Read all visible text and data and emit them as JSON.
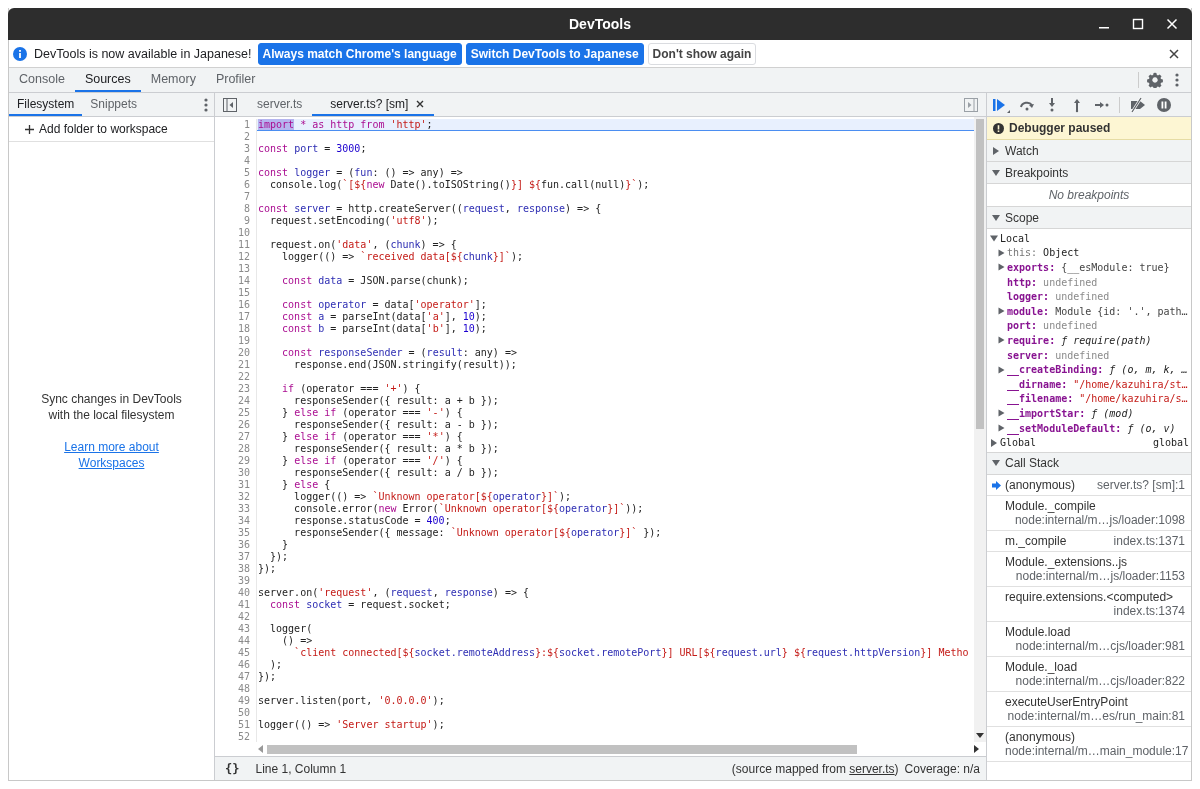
{
  "window": {
    "title": "DevTools"
  },
  "infobar": {
    "message": "DevTools is now available in Japanese!",
    "buttons": [
      {
        "label": "Always match Chrome's language",
        "primary": true
      },
      {
        "label": "Switch DevTools to Japanese",
        "primary": true
      },
      {
        "label": "Don't show again",
        "primary": false
      }
    ]
  },
  "main_tabs": [
    {
      "label": "Console",
      "selected": false
    },
    {
      "label": "Sources",
      "selected": true
    },
    {
      "label": "Memory",
      "selected": false
    },
    {
      "label": "Profiler",
      "selected": false
    }
  ],
  "navigator": {
    "tabs": [
      {
        "label": "Filesystem",
        "selected": true
      },
      {
        "label": "Snippets",
        "selected": false
      }
    ],
    "add_folder": "Add folder to workspace",
    "empty_message": "Sync changes in DevTools with the local filesystem",
    "learn_more_link": "Learn more about Workspaces"
  },
  "editor": {
    "tabs": [
      {
        "label": "server.ts",
        "selected": false,
        "closable": false
      },
      {
        "label": "server.ts? [sm]",
        "selected": true,
        "closable": true
      }
    ],
    "lines": [
      {
        "number": "1",
        "current": true,
        "tokens": [
          {
            "kind": "keyword",
            "text": "import",
            "selected": true
          },
          {
            "kind": "keyword",
            "text": " * as http from "
          },
          {
            "kind": "string",
            "text": "'http'"
          },
          {
            "kind": "plain",
            "text": ";"
          }
        ]
      },
      {
        "number": "2",
        "current": false
      },
      {
        "number": "3",
        "current": false,
        "tokens": [
          {
            "kind": "keyword",
            "text": "const "
          },
          {
            "kind": "variable",
            "text": "port"
          },
          {
            "kind": "plain",
            "text": " = "
          },
          {
            "kind": "number",
            "text": "3000"
          },
          {
            "kind": "plain",
            "text": ";"
          }
        ]
      },
      {
        "number": "4",
        "current": false
      },
      {
        "number": "5",
        "current": false,
        "tokens": [
          {
            "kind": "keyword",
            "text": "const "
          },
          {
            "kind": "variable",
            "text": "logger"
          },
          {
            "kind": "plain",
            "text": " = ("
          },
          {
            "kind": "variable",
            "text": "fun"
          },
          {
            "kind": "plain",
            "text": ": () => any) =>"
          }
        ]
      },
      {
        "number": "6",
        "current": false,
        "tokens": [
          {
            "kind": "plain",
            "text": "  console.log("
          },
          {
            "kind": "string",
            "text": "`[${"
          },
          {
            "kind": "keyword",
            "text": "new"
          },
          {
            "kind": "plain",
            "text": " Date().toISOString()"
          },
          {
            "kind": "string",
            "text": "}] ${"
          },
          {
            "kind": "plain",
            "text": "fun.call(null)"
          },
          {
            "kind": "string",
            "text": "}`"
          },
          {
            "kind": "plain",
            "text": ");"
          }
        ]
      },
      {
        "number": "7",
        "current": false
      },
      {
        "number": "8",
        "current": false,
        "tokens": [
          {
            "kind": "keyword",
            "text": "const "
          },
          {
            "kind": "variable",
            "text": "server"
          },
          {
            "kind": "plain",
            "text": " = http.createServer(("
          },
          {
            "kind": "variable",
            "text": "request"
          },
          {
            "kind": "plain",
            "text": ", "
          },
          {
            "kind": "variable",
            "text": "response"
          },
          {
            "kind": "plain",
            "text": ") => {"
          }
        ]
      },
      {
        "number": "9",
        "current": false,
        "tokens": [
          {
            "kind": "plain",
            "text": "  request.setEncoding("
          },
          {
            "kind": "string",
            "text": "'utf8'"
          },
          {
            "kind": "plain",
            "text": ");"
          }
        ]
      },
      {
        "number": "10",
        "current": false
      },
      {
        "number": "11",
        "current": false,
        "tokens": [
          {
            "kind": "plain",
            "text": "  request.on("
          },
          {
            "kind": "string",
            "text": "'data'"
          },
          {
            "kind": "plain",
            "text": ", ("
          },
          {
            "kind": "variable",
            "text": "chunk"
          },
          {
            "kind": "plain",
            "text": ") => {"
          }
        ]
      },
      {
        "number": "12",
        "current": false,
        "tokens": [
          {
            "kind": "plain",
            "text": "    logger(() => "
          },
          {
            "kind": "string",
            "text": "`received data[${"
          },
          {
            "kind": "variable",
            "text": "chunk"
          },
          {
            "kind": "string",
            "text": "}]`"
          },
          {
            "kind": "plain",
            "text": ");"
          }
        ]
      },
      {
        "number": "13",
        "current": false
      },
      {
        "number": "14",
        "current": false,
        "tokens": [
          {
            "kind": "keyword",
            "text": "    const "
          },
          {
            "kind": "variable",
            "text": "data"
          },
          {
            "kind": "plain",
            "text": " = JSON.parse(chunk);"
          }
        ]
      },
      {
        "number": "15",
        "current": false
      },
      {
        "number": "16",
        "current": false,
        "tokens": [
          {
            "kind": "keyword",
            "text": "    const "
          },
          {
            "kind": "variable",
            "text": "operator"
          },
          {
            "kind": "plain",
            "text": " = data["
          },
          {
            "kind": "string",
            "text": "'operator'"
          },
          {
            "kind": "plain",
            "text": "];"
          }
        ]
      },
      {
        "number": "17",
        "current": false,
        "tokens": [
          {
            "kind": "keyword",
            "text": "    const "
          },
          {
            "kind": "variable",
            "text": "a"
          },
          {
            "kind": "plain",
            "text": " = parseInt(data["
          },
          {
            "kind": "string",
            "text": "'a'"
          },
          {
            "kind": "plain",
            "text": "], "
          },
          {
            "kind": "number",
            "text": "10"
          },
          {
            "kind": "plain",
            "text": ");"
          }
        ]
      },
      {
        "number": "18",
        "current": false,
        "tokens": [
          {
            "kind": "keyword",
            "text": "    const "
          },
          {
            "kind": "variable",
            "text": "b"
          },
          {
            "kind": "plain",
            "text": " = parseInt(data["
          },
          {
            "kind": "string",
            "text": "'b'"
          },
          {
            "kind": "plain",
            "text": "], "
          },
          {
            "kind": "number",
            "text": "10"
          },
          {
            "kind": "plain",
            "text": ");"
          }
        ]
      },
      {
        "number": "19",
        "current": false
      },
      {
        "number": "20",
        "current": false,
        "tokens": [
          {
            "kind": "keyword",
            "text": "    const "
          },
          {
            "kind": "variable",
            "text": "responseSender"
          },
          {
            "kind": "plain",
            "text": " = ("
          },
          {
            "kind": "variable",
            "text": "result"
          },
          {
            "kind": "plain",
            "text": ": any) =>"
          }
        ]
      },
      {
        "number": "21",
        "current": false,
        "tokens": [
          {
            "kind": "plain",
            "text": "      response.end(JSON.stringify(result));"
          }
        ]
      },
      {
        "number": "22",
        "current": false
      },
      {
        "number": "23",
        "current": false,
        "tokens": [
          {
            "kind": "keyword",
            "text": "    if"
          },
          {
            "kind": "plain",
            "text": " (operator === "
          },
          {
            "kind": "string",
            "text": "'+'"
          },
          {
            "kind": "plain",
            "text": ") {"
          }
        ]
      },
      {
        "number": "24",
        "current": false,
        "tokens": [
          {
            "kind": "plain",
            "text": "      responseSender({ result: a + b });"
          }
        ]
      },
      {
        "number": "25",
        "current": false,
        "tokens": [
          {
            "kind": "plain",
            "text": "    } "
          },
          {
            "kind": "keyword",
            "text": "else if"
          },
          {
            "kind": "plain",
            "text": " (operator === "
          },
          {
            "kind": "string",
            "text": "'-'"
          },
          {
            "kind": "plain",
            "text": ") {"
          }
        ]
      },
      {
        "number": "26",
        "current": false,
        "tokens": [
          {
            "kind": "plain",
            "text": "      responseSender({ result: a - b });"
          }
        ]
      },
      {
        "number": "27",
        "current": false,
        "tokens": [
          {
            "kind": "plain",
            "text": "    } "
          },
          {
            "kind": "keyword",
            "text": "else if"
          },
          {
            "kind": "plain",
            "text": " (operator === "
          },
          {
            "kind": "string",
            "text": "'*'"
          },
          {
            "kind": "plain",
            "text": ") {"
          }
        ]
      },
      {
        "number": "28",
        "current": false,
        "tokens": [
          {
            "kind": "plain",
            "text": "      responseSender({ result: a * b });"
          }
        ]
      },
      {
        "number": "29",
        "current": false,
        "tokens": [
          {
            "kind": "plain",
            "text": "    } "
          },
          {
            "kind": "keyword",
            "text": "else if"
          },
          {
            "kind": "plain",
            "text": " (operator === "
          },
          {
            "kind": "string",
            "text": "'/'"
          },
          {
            "kind": "plain",
            "text": ") {"
          }
        ]
      },
      {
        "number": "30",
        "current": false,
        "tokens": [
          {
            "kind": "plain",
            "text": "      responseSender({ result: a / b });"
          }
        ]
      },
      {
        "number": "31",
        "current": false,
        "tokens": [
          {
            "kind": "plain",
            "text": "    } "
          },
          {
            "kind": "keyword",
            "text": "else"
          },
          {
            "kind": "plain",
            "text": " {"
          }
        ]
      },
      {
        "number": "32",
        "current": false,
        "tokens": [
          {
            "kind": "plain",
            "text": "      logger(() => "
          },
          {
            "kind": "string",
            "text": "`Unknown operator[${"
          },
          {
            "kind": "variable",
            "text": "operator"
          },
          {
            "kind": "string",
            "text": "}]`"
          },
          {
            "kind": "plain",
            "text": ");"
          }
        ]
      },
      {
        "number": "33",
        "current": false,
        "tokens": [
          {
            "kind": "plain",
            "text": "      console.error("
          },
          {
            "kind": "keyword",
            "text": "new"
          },
          {
            "kind": "plain",
            "text": " Error("
          },
          {
            "kind": "string",
            "text": "`Unknown operator[${"
          },
          {
            "kind": "variable",
            "text": "operator"
          },
          {
            "kind": "string",
            "text": "}]`"
          },
          {
            "kind": "plain",
            "text": "));"
          }
        ]
      },
      {
        "number": "34",
        "current": false,
        "tokens": [
          {
            "kind": "plain",
            "text": "      response.statusCode = "
          },
          {
            "kind": "number",
            "text": "400"
          },
          {
            "kind": "plain",
            "text": ";"
          }
        ]
      },
      {
        "number": "35",
        "current": false,
        "tokens": [
          {
            "kind": "plain",
            "text": "      responseSender({ message: "
          },
          {
            "kind": "string",
            "text": "`Unknown operator[${"
          },
          {
            "kind": "variable",
            "text": "operator"
          },
          {
            "kind": "string",
            "text": "}]`"
          },
          {
            "kind": "plain",
            "text": " });"
          }
        ]
      },
      {
        "number": "36",
        "current": false,
        "tokens": [
          {
            "kind": "plain",
            "text": "    }"
          }
        ]
      },
      {
        "number": "37",
        "current": false,
        "tokens": [
          {
            "kind": "plain",
            "text": "  });"
          }
        ]
      },
      {
        "number": "38",
        "current": false,
        "tokens": [
          {
            "kind": "plain",
            "text": "});"
          }
        ]
      },
      {
        "number": "39",
        "current": false
      },
      {
        "number": "40",
        "current": false,
        "tokens": [
          {
            "kind": "plain",
            "text": "server.on("
          },
          {
            "kind": "string",
            "text": "'request'"
          },
          {
            "kind": "plain",
            "text": ", ("
          },
          {
            "kind": "variable",
            "text": "request"
          },
          {
            "kind": "plain",
            "text": ", "
          },
          {
            "kind": "variable",
            "text": "response"
          },
          {
            "kind": "plain",
            "text": ") => {"
          }
        ]
      },
      {
        "number": "41",
        "current": false,
        "tokens": [
          {
            "kind": "keyword",
            "text": "  const "
          },
          {
            "kind": "variable",
            "text": "socket"
          },
          {
            "kind": "plain",
            "text": " = request.socket;"
          }
        ]
      },
      {
        "number": "42",
        "current": false
      },
      {
        "number": "43",
        "current": false,
        "tokens": [
          {
            "kind": "plain",
            "text": "  logger("
          }
        ]
      },
      {
        "number": "44",
        "current": false,
        "tokens": [
          {
            "kind": "plain",
            "text": "    () =>"
          }
        ]
      },
      {
        "number": "45",
        "current": false,
        "tokens": [
          {
            "kind": "string",
            "text": "      `client connected[${"
          },
          {
            "kind": "variable",
            "text": "socket.remoteAddress"
          },
          {
            "kind": "string",
            "text": "}:${"
          },
          {
            "kind": "variable",
            "text": "socket.remotePort"
          },
          {
            "kind": "string",
            "text": "}] URL[${"
          },
          {
            "kind": "variable",
            "text": "request.url"
          },
          {
            "kind": "string",
            "text": "} ${"
          },
          {
            "kind": "variable",
            "text": "request.httpVersion"
          },
          {
            "kind": "string",
            "text": "}] Metho"
          }
        ]
      },
      {
        "number": "46",
        "current": false,
        "tokens": [
          {
            "kind": "plain",
            "text": "  );"
          }
        ]
      },
      {
        "number": "47",
        "current": false,
        "tokens": [
          {
            "kind": "plain",
            "text": "});"
          }
        ]
      },
      {
        "number": "48",
        "current": false
      },
      {
        "number": "49",
        "current": false,
        "tokens": [
          {
            "kind": "plain",
            "text": "server.listen(port, "
          },
          {
            "kind": "string",
            "text": "'0.0.0.0'"
          },
          {
            "kind": "plain",
            "text": ");"
          }
        ]
      },
      {
        "number": "50",
        "current": false
      },
      {
        "number": "51",
        "current": false,
        "tokens": [
          {
            "kind": "plain",
            "text": "logger(() => "
          },
          {
            "kind": "string",
            "text": "'Server startup'"
          },
          {
            "kind": "plain",
            "text": ");"
          }
        ]
      },
      {
        "number": "52",
        "current": false
      }
    ],
    "status_bar": {
      "format_button": "{}",
      "position": "Line 1, Column 1",
      "source_map_prefix": "(source mapped from ",
      "source_map_link": "server.ts",
      "source_map_suffix": ")",
      "coverage": "Coverage: n/a"
    }
  },
  "debugger": {
    "paused_banner": "Debugger paused",
    "sections": [
      {
        "kind": "watch",
        "title": "Watch",
        "expanded": false
      },
      {
        "kind": "breakpoints",
        "title": "Breakpoints",
        "expanded": true,
        "empty_text": "No breakpoints"
      },
      {
        "kind": "scope",
        "title": "Scope",
        "expanded": true,
        "groups": [
          {
            "title": "Local",
            "expanded": true,
            "items": [
              {
                "name": "this:",
                "value": "Object",
                "kind": "object",
                "expandable": true,
                "dimmed": true
              },
              {
                "name": "exports:",
                "value": "{__esModule: true}",
                "kind": "preview",
                "expandable": true,
                "dimmed": false
              },
              {
                "name": "http:",
                "value": "undefined",
                "kind": "undefined",
                "expandable": false,
                "dimmed": false
              },
              {
                "name": "logger:",
                "value": "undefined",
                "kind": "undefined",
                "expandable": false,
                "dimmed": false
              },
              {
                "name": "module:",
                "value": "Module {id: '.', path…",
                "kind": "preview",
                "expandable": true,
                "dimmed": false
              },
              {
                "name": "port:",
                "value": "undefined",
                "kind": "undefined",
                "expandable": false,
                "dimmed": false
              },
              {
                "name": "require:",
                "value": "ƒ require(path)",
                "kind": "function",
                "expandable": true,
                "dimmed": false
              },
              {
                "name": "server:",
                "value": "undefined",
                "kind": "undefined",
                "expandable": false,
                "dimmed": false
              },
              {
                "name": "__createBinding:",
                "value": "ƒ (o, m, k, …",
                "kind": "function",
                "expandable": true,
                "dimmed": false
              },
              {
                "name": "__dirname:",
                "value": "\"/home/kazuhira/st…",
                "kind": "string",
                "expandable": false,
                "dimmed": false
              },
              {
                "name": "__filename:",
                "value": "\"/home/kazuhira/s…",
                "kind": "string",
                "expandable": false,
                "dimmed": false
              },
              {
                "name": "__importStar:",
                "value": "ƒ (mod)",
                "kind": "function",
                "expandable": true,
                "dimmed": false
              },
              {
                "name": "__setModuleDefault:",
                "value": "ƒ (o, v)",
                "kind": "function",
                "expandable": true,
                "dimmed": false
              }
            ]
          },
          {
            "title": "Global",
            "expanded": false,
            "value": "global"
          }
        ]
      },
      {
        "kind": "call_stack",
        "title": "Call Stack",
        "expanded": true,
        "frames": [
          {
            "function": "(anonymous)",
            "location": "server.ts? [sm]:1",
            "selected": true
          },
          {
            "function": "Module._compile",
            "location": "node:internal/m…js/loader:1098",
            "selected": false
          },
          {
            "function": "m._compile",
            "location": "index.ts:1371",
            "selected": false
          },
          {
            "function": "Module._extensions..js",
            "location": "node:internal/m…js/loader:1153",
            "selected": false
          },
          {
            "function": "require.extensions.<computed>",
            "location": "index.ts:1374",
            "selected": false
          },
          {
            "function": "Module.load",
            "location": "node:internal/m…cjs/loader:981",
            "selected": false
          },
          {
            "function": "Module._load",
            "location": "node:internal/m…cjs/loader:822",
            "selected": false
          },
          {
            "function": "executeUserEntryPoint",
            "location": "node:internal/m…es/run_main:81",
            "selected": false
          },
          {
            "function": "(anonymous)",
            "location": "node:internal/m…main_module:17",
            "selected": false
          }
        ]
      }
    ]
  }
}
